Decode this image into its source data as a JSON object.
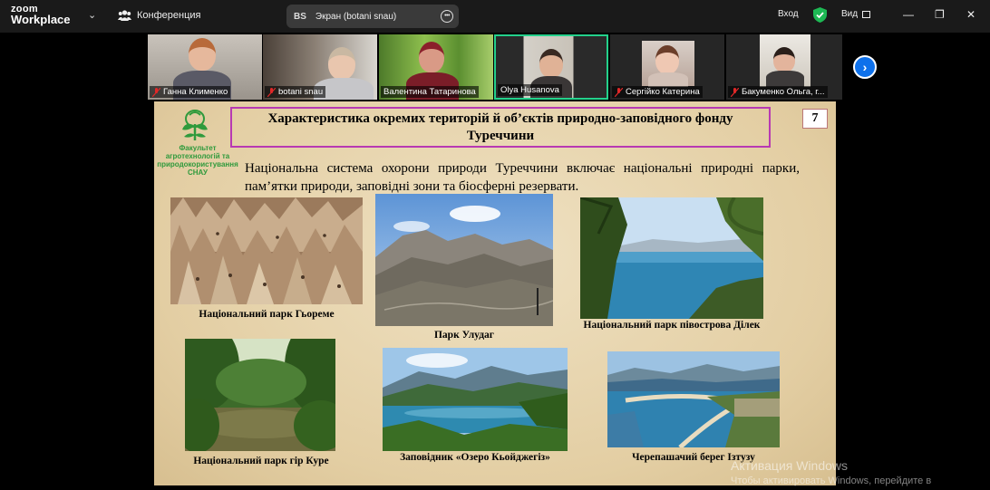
{
  "app": {
    "logo_line1": "zoom",
    "logo_line2": "Workplace"
  },
  "topbar": {
    "conference_label": "Конференция",
    "screen_badge": "BS",
    "screen_label": "Экран (botani snau)",
    "signin_label": "Вход",
    "view_label": "Вид",
    "window_controls": [
      "—",
      "❐",
      "✕"
    ]
  },
  "participants": [
    {
      "name": "Ганна Клименко",
      "muted": true
    },
    {
      "name": "botani snau",
      "muted": true
    },
    {
      "name": "Валентина Татаринова",
      "muted": false
    },
    {
      "name": "Olya Husanova",
      "muted": false,
      "active": true
    },
    {
      "name": "Сергійко Катерина",
      "muted": true
    },
    {
      "name": "Бакуменко Ольга, г...",
      "muted": true
    }
  ],
  "slide": {
    "faculty_text": "Факультет\nагротехнологій та\nприродокористування\nСНАУ",
    "title": "Характеристика окремих територій й об’єктів природно-заповідного фонду Туреччини",
    "page_number": "7",
    "intro": "Національна система охорони природи Туреччини включає національні природні парки, пам’ятки природи, заповідні зони та біосферні резервати.",
    "captions": [
      "Національний парк Гьореме",
      "Парк Улудаг",
      "Національний парк півострова Ділек",
      "Національний парк гір Куре",
      "Заповідник «Озеро Кьойджегіз»",
      "Черепашачий берег Ізтузу"
    ]
  },
  "watermark": {
    "line1": "Активация Windows",
    "line2": "Чтобы активировать Windows, перейдите в"
  },
  "colors": {
    "accent": "#0e71eb",
    "active_border": "#23d18b",
    "title_border": "#b839b3",
    "shield": "#1db954"
  }
}
